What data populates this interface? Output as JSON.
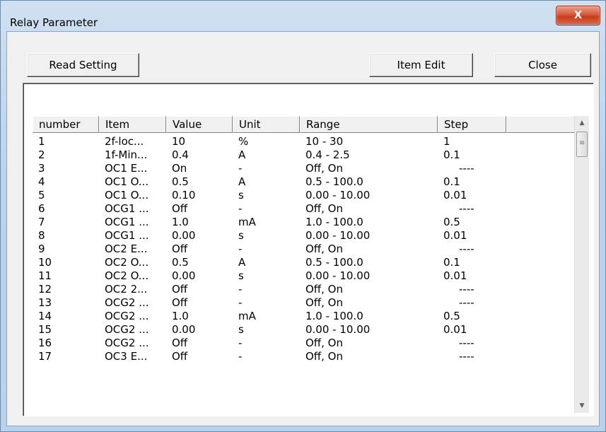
{
  "window": {
    "title": "Relay Parameter",
    "close_glyph": "X"
  },
  "toolbar": {
    "read_setting_label": "Read Setting",
    "item_edit_label": "Item Edit",
    "close_label": "Close"
  },
  "table": {
    "columns": [
      "number",
      "Item",
      "Value",
      "Unit",
      "Range",
      "Step",
      ""
    ],
    "rows": [
      [
        "1",
        "2f-loc...",
        "10",
        "%",
        "10 - 30",
        "1"
      ],
      [
        "2",
        "1f-Min...",
        "0.4",
        "A",
        "0.4 - 2.5",
        "0.1"
      ],
      [
        "3",
        "OC1 E...",
        "On",
        "-",
        "Off, On",
        "----"
      ],
      [
        "4",
        "OC1 O...",
        "0.5",
        "A",
        "0.5 - 100.0",
        "0.1"
      ],
      [
        "5",
        "OC1 O...",
        "0.10",
        "s",
        "0.00 - 10.00",
        "0.01"
      ],
      [
        "6",
        "OCG1 ...",
        "Off",
        "-",
        "Off, On",
        "----"
      ],
      [
        "7",
        "OCG1 ...",
        "1.0",
        "mA",
        "1.0 - 100.0",
        "0.5"
      ],
      [
        "8",
        "OCG1 ...",
        "0.00",
        "s",
        "0.00 - 10.00",
        "0.01"
      ],
      [
        "9",
        "OC2 E...",
        "Off",
        "-",
        "Off, On",
        "----"
      ],
      [
        "10",
        "OC2 O...",
        "0.5",
        "A",
        "0.5 - 100.0",
        "0.1"
      ],
      [
        "11",
        "OC2 O...",
        "0.00",
        "s",
        "0.00 - 10.00",
        "0.01"
      ],
      [
        "12",
        "OC2 2...",
        "Off",
        "-",
        "Off, On",
        "----"
      ],
      [
        "13",
        "OCG2 ...",
        "Off",
        "-",
        "Off, On",
        "----"
      ],
      [
        "14",
        "OCG2 ...",
        "1.0",
        "mA",
        "1.0 - 100.0",
        "0.5"
      ],
      [
        "15",
        "OCG2 ...",
        "0.00",
        "s",
        "0.00 - 10.00",
        "0.01"
      ],
      [
        "16",
        "OCG2 ...",
        "Off",
        "-",
        "Off, On",
        "----"
      ],
      [
        "17",
        "OC3 E...",
        "Off",
        "-",
        "Off, On",
        "----"
      ]
    ]
  },
  "scrollbar": {
    "up_glyph": "▲",
    "down_glyph": "▼",
    "grip_glyph": "≡"
  },
  "icons": {
    "close": "close-icon",
    "scroll_up": "chevron-up-icon",
    "scroll_down": "chevron-down-icon"
  }
}
